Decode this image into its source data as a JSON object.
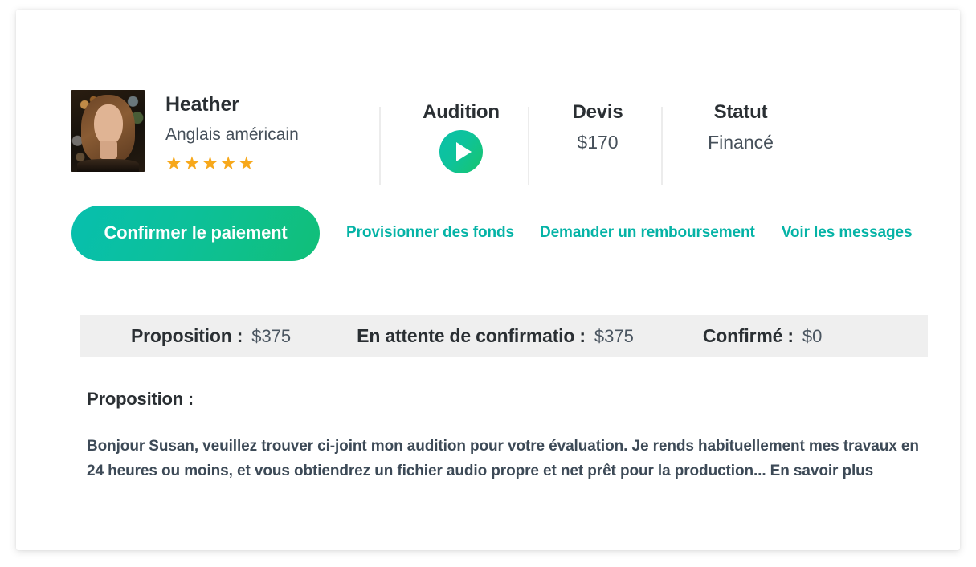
{
  "profile": {
    "name": "Heather",
    "language": "Anglais américain",
    "stars": "★★★★★",
    "rating": 5
  },
  "stats": [
    {
      "label": "Audition",
      "value": "",
      "icon": "play-icon"
    },
    {
      "label": "Devis",
      "value": "$170"
    },
    {
      "label": "Statut",
      "value": "Financé"
    }
  ],
  "actions": {
    "primary_label": "Confirmer le paiement",
    "links": [
      "Provisionner des fonds",
      "Demander un remboursement",
      "Voir les messages"
    ]
  },
  "summary": [
    {
      "label": "Proposition :",
      "value": "$375"
    },
    {
      "label": "En attente de confirmatio :",
      "value": "$375"
    },
    {
      "label": "Confirmé :",
      "value": "$0"
    }
  ],
  "proposal": {
    "title": "Proposition :",
    "body": "Bonjour Susan, veuillez trouver ci-joint mon audition pour votre évaluation. Je rends habituellement mes travaux en 24 heures ou moins, et vous obtiendrez un fichier audio propre et net prêt pour la production... En savoir plus"
  },
  "colors": {
    "accent_teal": "#05b3a6",
    "button_gradient_start": "#07bfae",
    "button_gradient_end": "#11bf78",
    "star_gold": "#f7a81b",
    "summary_bar_bg": "#efefef",
    "text_dark": "#2a2f33",
    "text_slate": "#46505a"
  }
}
